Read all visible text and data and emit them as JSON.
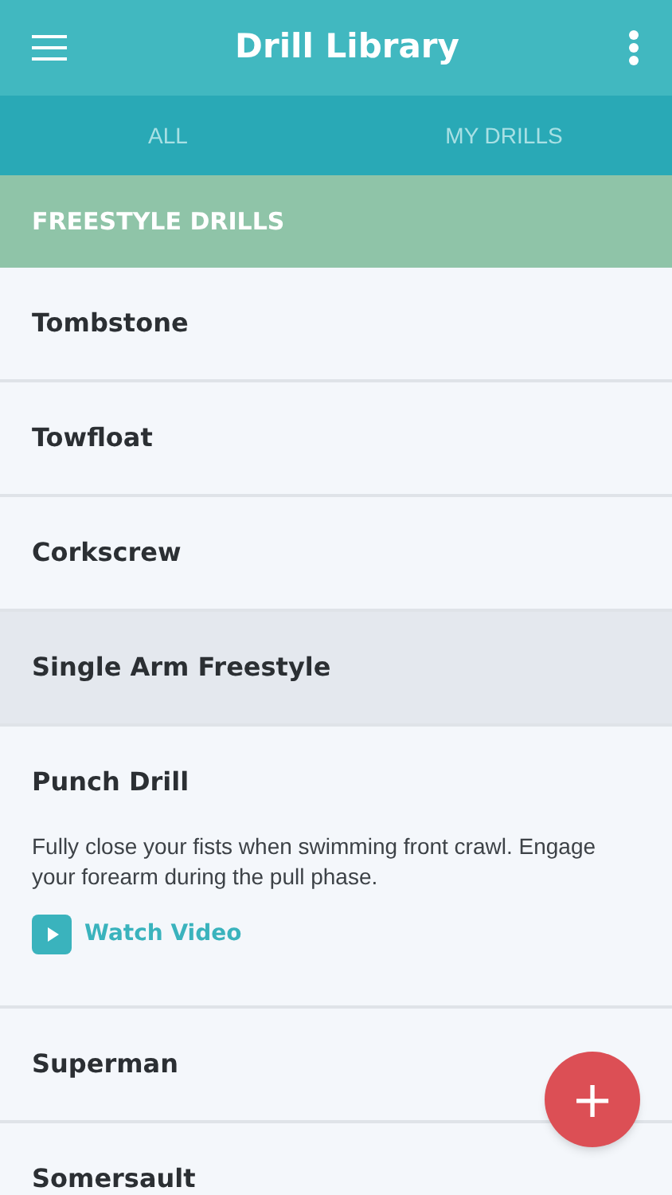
{
  "app_bar": {
    "title": "Drill Library"
  },
  "tabs": [
    {
      "label": "ALL"
    },
    {
      "label": "MY DRILLS"
    }
  ],
  "section": {
    "title": "FREESTYLE DRILLS"
  },
  "drills": [
    {
      "name": "Tombstone",
      "selected": false,
      "expanded": false
    },
    {
      "name": "Towfloat",
      "selected": false,
      "expanded": false
    },
    {
      "name": "Corkscrew",
      "selected": false,
      "expanded": false
    },
    {
      "name": "Single Arm Freestyle",
      "selected": true,
      "expanded": false
    },
    {
      "name": "Punch Drill",
      "selected": false,
      "expanded": true,
      "description": "Fully close your fists when swimming front crawl. Engage your forearm during the pull phase.",
      "link": "Watch Video"
    },
    {
      "name": "Superman",
      "selected": false,
      "expanded": false
    },
    {
      "name": "Somersault",
      "selected": false,
      "expanded": false
    }
  ],
  "fab": {
    "label": "+"
  }
}
